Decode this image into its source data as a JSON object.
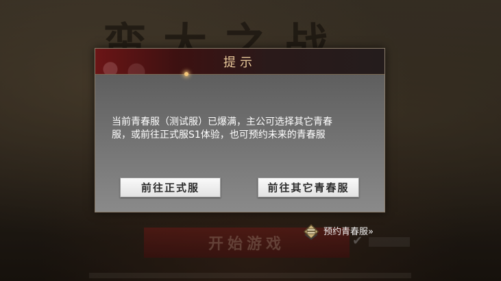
{
  "background": {
    "game_title": "蛮大之战",
    "start_button_label": "开始游戏"
  },
  "dialog": {
    "title": "提示",
    "message": "当前青春服（测试服）已爆满，主公可选择其它青春\n服，或前往正式服S1体验，也可预约未来的青春服",
    "buttons": {
      "official": "前往正式服",
      "other": "前往其它青春服"
    }
  },
  "reserve": {
    "label": "预约青春服»",
    "icon": "reserve-scroll-icon"
  },
  "colors": {
    "title_gold": "#e8c89a",
    "header_red": "#6b1516",
    "button_bg": "#f0f0f0"
  }
}
